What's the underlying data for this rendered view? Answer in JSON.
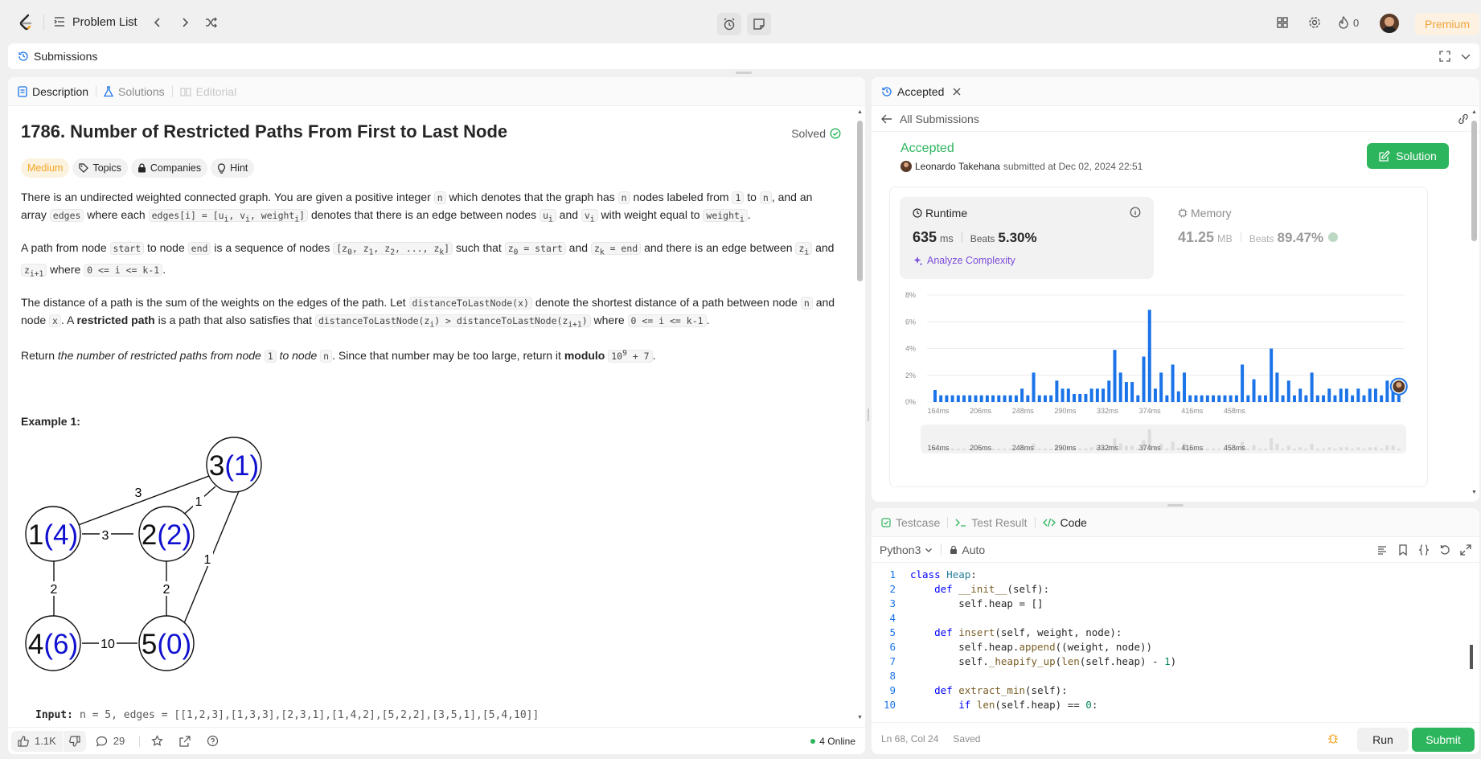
{
  "topbar": {
    "problem_list": "Problem List",
    "fire_count": "0",
    "premium": "Premium"
  },
  "subbar": {
    "title": "Submissions"
  },
  "left": {
    "tabs": {
      "description": "Description",
      "solutions": "Solutions",
      "editorial": "Editorial"
    },
    "title": "1786. Number of Restricted Paths From First to Last Node",
    "solved": "Solved",
    "tags": {
      "difficulty": "Medium",
      "topics": "Topics",
      "companies": "Companies",
      "hint": "Hint"
    },
    "example_heading": "Example 1:",
    "input_label": "Input:",
    "input_value": "n = 5, edges = [[1,2,3],[1,3,3],[2,3,1],[1,4,2],[5,2,2],[3,5,1],[5,4,10]]",
    "graph": {
      "nodes": [
        {
          "label": "1",
          "dist": "(4)"
        },
        {
          "label": "2",
          "dist": "(2)"
        },
        {
          "label": "3",
          "dist": "(1)"
        },
        {
          "label": "4",
          "dist": "(6)"
        },
        {
          "label": "5",
          "dist": "(0)"
        }
      ],
      "edge_weights": {
        "e13": "3",
        "e12": "3",
        "e23": "1",
        "e14": "2",
        "e25": "2",
        "e35": "1",
        "e45": "10"
      }
    },
    "footer": {
      "likes": "1.1K",
      "comments": "29",
      "online": "4 Online"
    }
  },
  "right": {
    "tab_label": "Accepted",
    "back_label": "All Submissions",
    "status": "Accepted",
    "user": "Leonardo Takehana",
    "submitted_text": "submitted at Dec 02, 2024 22:51",
    "solution_btn": "Solution",
    "runtime": {
      "label": "Runtime",
      "value": "635",
      "unit": "ms",
      "beats_label": "Beats",
      "beats": "5.30%"
    },
    "memory": {
      "label": "Memory",
      "value": "41.25",
      "unit": "MB",
      "beats_label": "Beats",
      "beats": "89.47%"
    },
    "analyze": "Analyze Complexity",
    "colors": {
      "accent_green": "#2db55d",
      "bar_blue": "#1a73e8",
      "analyze_purple": "#7b4ddb"
    }
  },
  "chart_data": {
    "type": "bar",
    "ylabel_ticks": [
      "0%",
      "2%",
      "4%",
      "6%",
      "8%"
    ],
    "ylim": [
      0,
      8
    ],
    "xtick_labels": [
      "164ms",
      "206ms",
      "248ms",
      "290ms",
      "332ms",
      "374ms",
      "416ms",
      "458ms"
    ],
    "values": [
      0.9,
      0.5,
      0.5,
      0.5,
      0.5,
      0.5,
      0.5,
      0.5,
      0.5,
      0.5,
      0.5,
      0.5,
      0.5,
      0.5,
      0.5,
      1.0,
      0.5,
      2.2,
      0.5,
      0.5,
      0.5,
      1.6,
      1.0,
      1.0,
      0.6,
      0.6,
      0.6,
      1.0,
      1.0,
      1.0,
      1.6,
      3.9,
      2.2,
      1.5,
      1.5,
      0.5,
      3.4,
      6.9,
      1.0,
      2.2,
      0.5,
      2.8,
      0.8,
      2.2,
      0.5,
      0.5,
      0.5,
      0.5,
      0.5,
      0.5,
      0.5,
      0.5,
      0.5,
      2.8,
      0.5,
      1.7,
      0.5,
      0.5,
      4.0,
      2.2,
      0.5,
      1.6,
      0.5,
      1.0,
      0.5,
      2.2,
      0.5,
      0.5,
      1.0,
      0.5,
      1.0,
      1.0,
      0.5,
      1.0,
      0.5,
      1.0,
      1.0,
      0.5,
      1.6,
      1.6,
      0.5
    ],
    "highlight_index": 80
  },
  "code": {
    "tabs": {
      "testcase": "Testcase",
      "result": "Test Result",
      "code": "Code"
    },
    "language": "Python3",
    "auto": "Auto",
    "lines": [
      "class Heap:",
      "    def __init__(self):",
      "        self.heap = []",
      "",
      "    def insert(self, weight, node):",
      "        self.heap.append((weight, node))",
      "        self._heapify_up(len(self.heap) - 1)",
      "",
      "    def extract_min(self):",
      "        if len(self.heap) == 0:"
    ],
    "status": "Ln 68, Col 24",
    "saved": "Saved",
    "run": "Run",
    "submit": "Submit"
  }
}
